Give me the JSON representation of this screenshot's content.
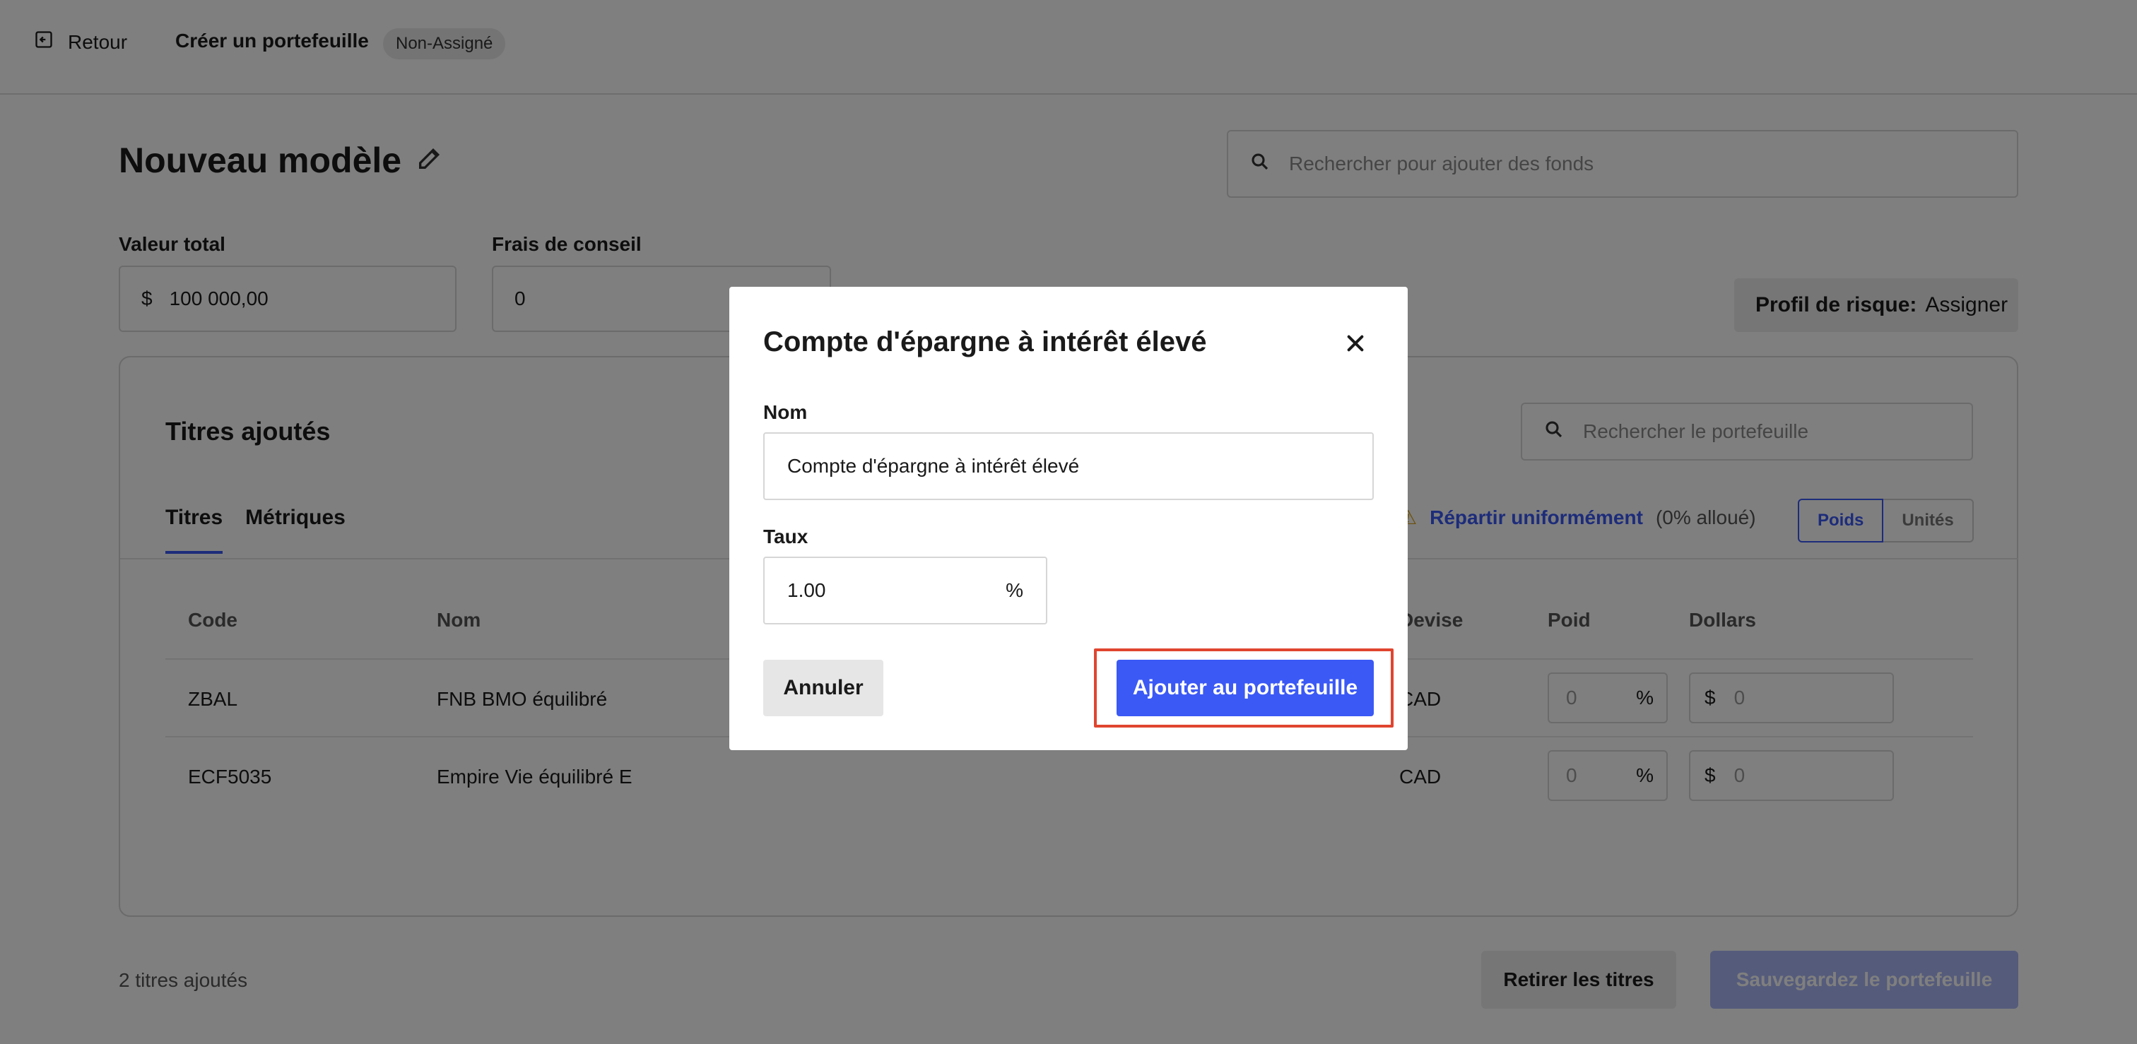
{
  "header": {
    "back_label": "Retour",
    "title": "Créer un portefeuille",
    "badge": "Non-Assigné"
  },
  "model": {
    "title": "Nouveau modèle",
    "search_funds_placeholder": "Rechercher pour ajouter des fonds",
    "total_value_label": "Valeur total",
    "total_value_currency": "$",
    "total_value": "100 000,00",
    "advisory_fee_label": "Frais de conseil",
    "advisory_fee": "0",
    "risk_label": "Profil de risque:",
    "risk_value": "Assigner"
  },
  "card": {
    "title": "Titres ajoutés",
    "search_placeholder": "Rechercher le portefeuille",
    "tabs": [
      {
        "label": "Titres",
        "active": true
      },
      {
        "label": "Métriques",
        "active": false
      }
    ],
    "allocate_link": "Répartir uniformément",
    "allocated_text": "(0% alloué)",
    "toggle": {
      "weight": "Poids",
      "units": "Unités"
    },
    "columns": {
      "code": "Code",
      "name": "Nom",
      "currency": "Devise",
      "weight": "Poid",
      "dollars": "Dollars"
    },
    "rows": [
      {
        "code": "ZBAL",
        "name": "FNB BMO équilibré",
        "currency": "CAD",
        "weight": "0",
        "weight_unit": "%",
        "dollar_sign": "$",
        "dollars": "0"
      },
      {
        "code": "ECF5035",
        "name": "Empire Vie équilibré E",
        "currency": "CAD",
        "weight": "0",
        "weight_unit": "%",
        "dollar_sign": "$",
        "dollars": "0"
      }
    ]
  },
  "footer": {
    "count": "2 titres ajoutés",
    "remove_label": "Retirer les titres",
    "save_label": "Sauvegardez le portefeuille"
  },
  "modal": {
    "title": "Compte d'épargne à intérêt élevé",
    "name_label": "Nom",
    "name_value": "Compte d'épargne à intérêt élevé",
    "rate_label": "Taux",
    "rate_value": "1.00",
    "rate_suffix": "%",
    "cancel_label": "Annuler",
    "add_label": "Ajouter au portefeuille"
  },
  "colors": {
    "accent": "#3b59f5",
    "highlight": "#e0452f",
    "warning": "#d9a21b"
  }
}
